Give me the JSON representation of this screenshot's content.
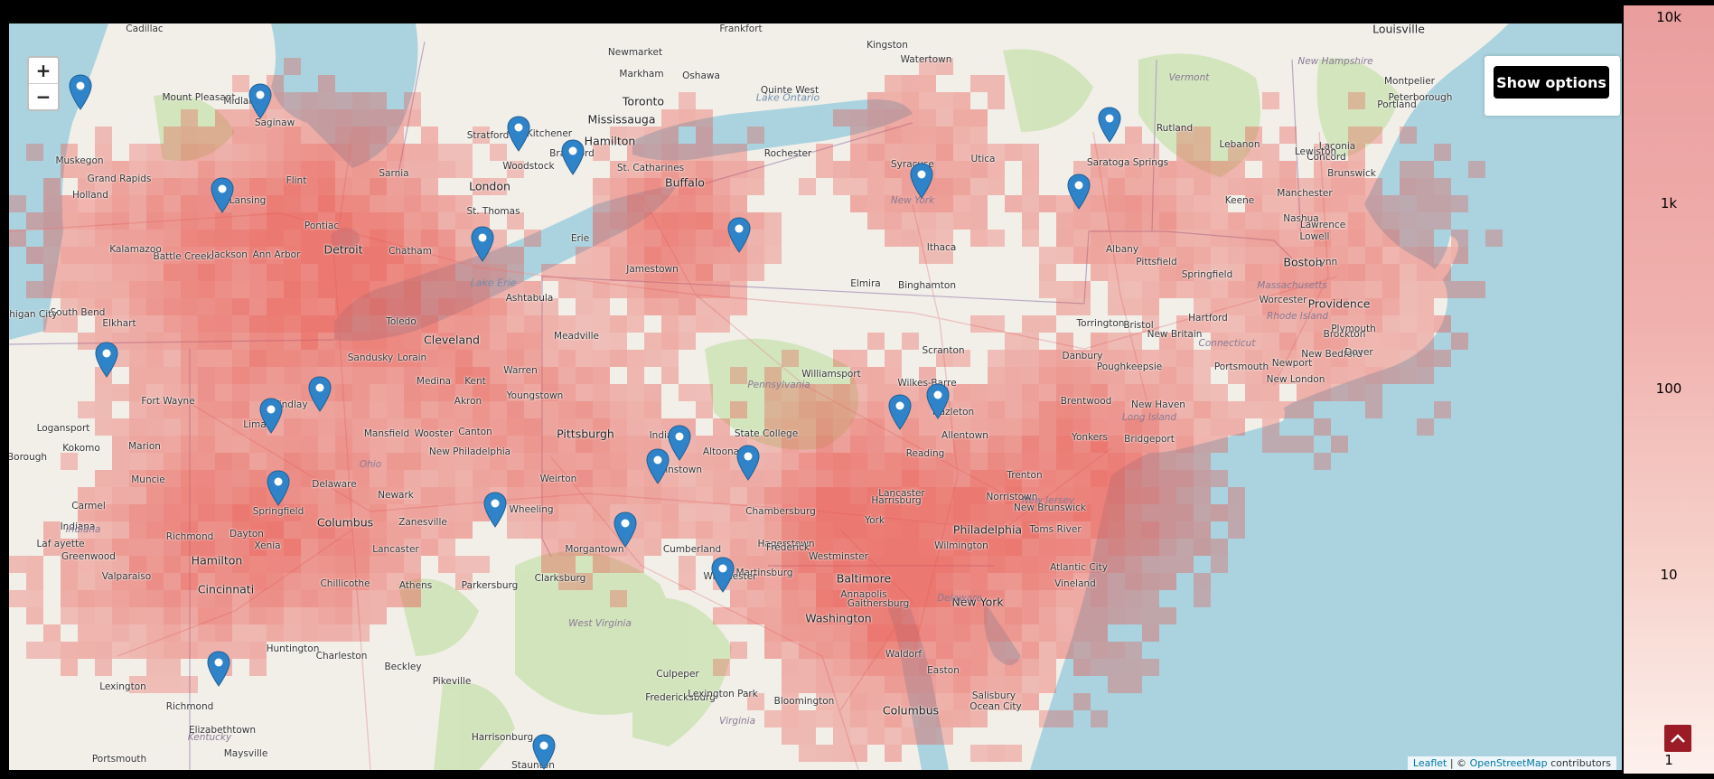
{
  "controls": {
    "zoom_in": "+",
    "zoom_out": "−",
    "options_label": "Show options",
    "scroll_top_icon": "chevron-up-icon"
  },
  "attribution": {
    "leaflet": "Leaflet",
    "separator": "| ©",
    "osm": "OpenStreetMap",
    "suffix": "contributors"
  },
  "legend": {
    "ticks": [
      "10k",
      "1k",
      "100",
      "10",
      "1"
    ],
    "color_high": "#ea9e9e",
    "color_low": "#fdf1ed"
  },
  "colors": {
    "water": "#aad3df",
    "land": "#f2efe9",
    "forest": "#c8dfb0",
    "marker": "#2f83c9",
    "heat": "#e8524a"
  },
  "cities": [
    "Cadillac",
    "Mount Pleasant",
    "Midland",
    "Saginaw",
    "Muskegon",
    "Grand Rapids",
    "Holland",
    "Flint",
    "Lansing",
    "Pontiac",
    "Battle Creek",
    "Kalamazoo",
    "Jackson",
    "Ann Arbor",
    "Detroit",
    "Sarnia",
    "Chatham",
    "London",
    "St. Thomas",
    "Stratford",
    "Kitchener",
    "Woodstock",
    "Brantford",
    "Hamilton",
    "Mississauga",
    "Toronto",
    "Newmarket",
    "Markham",
    "Oshawa",
    "Kingston",
    "Watertown",
    "Quinte West",
    "St. Catharines",
    "Buffalo",
    "Rochester",
    "Syracuse",
    "Utica",
    "Erie",
    "Jamestown",
    "Ithaca",
    "Elmira",
    "Binghamton",
    "Ashtabula",
    "Toledo",
    "Cleveland",
    "Lorain",
    "Sandusky",
    "Elkhart",
    "South Bend",
    "Michigan City",
    "Fort Wayne",
    "Logansport",
    "Lima",
    "Findlay",
    "Marion",
    "Mansfield",
    "Medina",
    "Kent",
    "Akron",
    "Warren",
    "Youngstown",
    "Meadville",
    "Wooster",
    "Canton",
    "New Philadelphia",
    "Kokomo",
    "Muncie",
    "Delaware",
    "Newark",
    "Columbus",
    "Zanesville",
    "Springfield",
    "Dayton",
    "Xenia",
    "Richmond",
    "Carmel",
    "Indiana",
    "Greenwood",
    "Hamilton",
    "Cincinnati",
    "Chillicothe",
    "Athens",
    "Lancaster",
    "Parkersburg",
    "Wheeling",
    "Weirton",
    "Pittsburgh",
    "Morgantown",
    "Clarksburg",
    "Johnstown",
    "Altoona",
    "State College",
    "Indiana",
    "Williamsport",
    "Scranton",
    "Wilkes-Barre",
    "Hazleton",
    "Allentown",
    "Reading",
    "Harrisburg",
    "Lancaster",
    "York",
    "Chambersburg",
    "Hagerstown",
    "Cumberland",
    "Martinsburg",
    "Winchester",
    "Frederick",
    "Westminster",
    "Baltimore",
    "Annapolis",
    "Washington",
    "Gaithersburg",
    "Waldorf",
    "Easton",
    "Salisbury",
    "Ocean City",
    "Wilmington",
    "Philadelphia",
    "Norristown",
    "Trenton",
    "New Brunswick",
    "Toms River",
    "Atlantic City",
    "Vineland",
    "New York",
    "Yonkers",
    "Brentwood",
    "Bridgeport",
    "New Haven",
    "Danbury",
    "Poughkeepsie",
    "Torrington",
    "Bristol",
    "Hartford",
    "New Britain",
    "Springfield",
    "Pittsfield",
    "Albany",
    "Saratoga Springs",
    "Rutland",
    "Lebanon",
    "Keene",
    "Concord",
    "Laconia",
    "Manchester",
    "Nashua",
    "Lowell",
    "Lawrence",
    "Lynn",
    "Boston",
    "Worcester",
    "Providence",
    "Brockton",
    "Plymouth",
    "New Bedford",
    "Newport",
    "New London",
    "Dover",
    "Portsmouth",
    "Lewiston",
    "Brunswick",
    "Portland",
    "Montpelier",
    "Peterborough",
    "Louisville",
    "Frankfort",
    "Lexington",
    "Richmond",
    "Elizabethtown",
    "Maysville",
    "Portsmouth",
    "Huntington",
    "Charleston",
    "Beckley",
    "Pikeville",
    "Harrisonburg",
    "Staunton",
    "Culpeper",
    "Fredericksburg",
    "Lexington Park",
    "Bloomington",
    "Columbus",
    "Laf ayette",
    "Valparaiso",
    "Borough"
  ],
  "water_labels": [
    "Lake Ontario",
    "Lake Erie"
  ],
  "state_labels": [
    "Vermont",
    "New Hampshire",
    "New York",
    "Pennsylvania",
    "Ohio",
    "Indiana",
    "West Virginia",
    "Virginia",
    "Kentucky",
    "New Jersey",
    "Delaware",
    "Connecticut",
    "Rhode Island",
    "Massachusetts",
    "Long Island"
  ],
  "markers": [
    "marker-muskegon",
    "marker-saginaw-bay",
    "marker-flint",
    "marker-hamilton",
    "marker-buffalo",
    "marker-erie",
    "marker-ithaca",
    "marker-albany",
    "marker-dover-nh",
    "marker-lowell",
    "marker-fort-wayne",
    "marker-marion",
    "marker-mansfield",
    "marker-columbus",
    "marker-morgantown",
    "marker-harrisburg",
    "marker-chambersburg",
    "marker-reading",
    "marker-hagerstown",
    "marker-annapolis",
    "marker-new-york",
    "marker-long-island",
    "marker-maysville",
    "marker-staunton"
  ]
}
